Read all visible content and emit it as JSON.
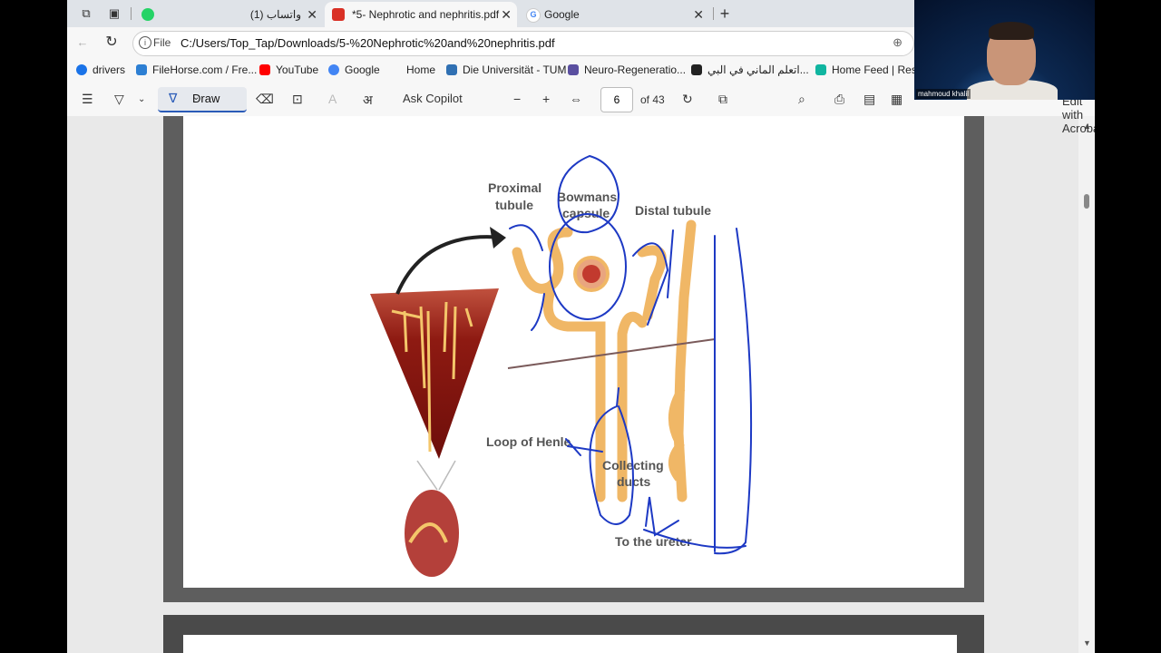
{
  "tabs": [
    {
      "title": "(1) واتساب",
      "active": false
    },
    {
      "title": "*5- Nephrotic and nephritis.pdf",
      "active": true
    },
    {
      "title": "Google",
      "active": false
    }
  ],
  "address": {
    "file_label": "File",
    "url": "C:/Users/Top_Tap/Downloads/5-%20Nephrotic%20and%20nephritis.pdf"
  },
  "bookmarks": [
    {
      "label": "drivers",
      "color": "#1a73e8"
    },
    {
      "label": "FileHorse.com / Fre...",
      "color": "#2d7fd3"
    },
    {
      "label": "YouTube",
      "color": "#ff0000"
    },
    {
      "label": "Google",
      "color": "#4285f4"
    },
    {
      "label": "Home",
      "color": ""
    },
    {
      "label": "Die Universität - TUM",
      "color": "#3070b3"
    },
    {
      "label": "Neuro-Regeneratio...",
      "color": "#5a4fa0"
    },
    {
      "label": "اتعلم الماني في البي...",
      "color": "#222222"
    },
    {
      "label": "Home Feed | Resea",
      "color": "#10b5a0"
    }
  ],
  "pdf_toolbar": {
    "draw_label": "Draw",
    "copilot_label": "Ask Copilot",
    "page_current": "6",
    "page_total": "of 43",
    "acrobat_label": "Edit with Acrobat"
  },
  "webcam": {
    "name": "mahmoud khalil"
  },
  "figure_labels": {
    "proximal": [
      "Proximal",
      "tubule"
    ],
    "bowmans": [
      "Bowmans",
      "capsule"
    ],
    "distal": "Distal tubule",
    "loop": "Loop of Henle",
    "collecting": [
      "Collecting",
      "ducts"
    ],
    "ureter": "To the ureter"
  }
}
